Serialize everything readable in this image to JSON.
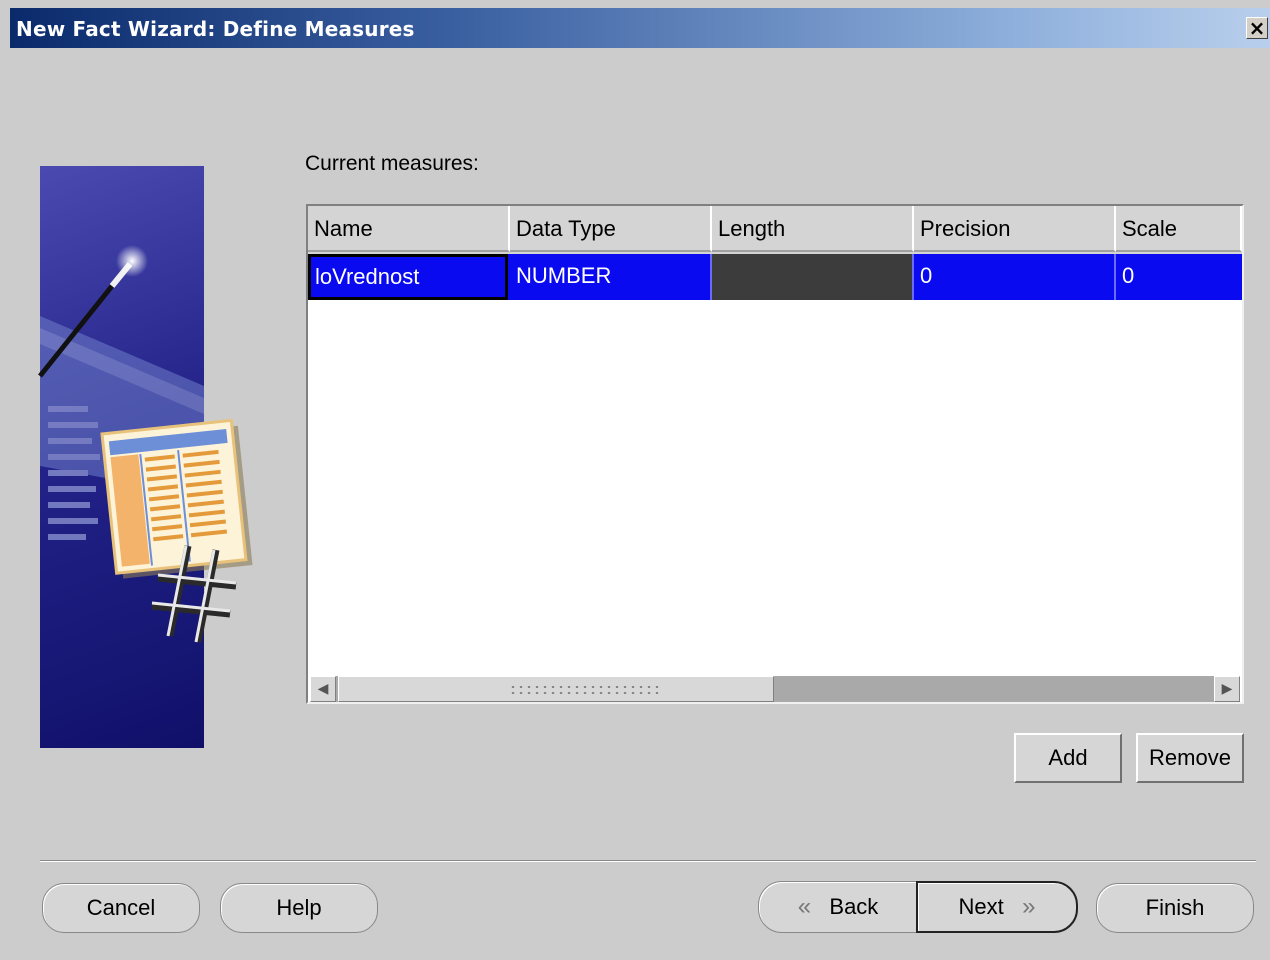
{
  "window": {
    "title": "New Fact Wizard: Define Measures",
    "close_label": "×"
  },
  "main": {
    "current_measures_label": "Current measures:",
    "columns": [
      "Name",
      "Data Type",
      "Length",
      "Precision",
      "Scale"
    ],
    "rows": [
      {
        "name": "loVrednost",
        "data_type": "NUMBER",
        "length": "",
        "precision": "0",
        "scale": "0"
      }
    ],
    "add_label": "Add",
    "remove_label": "Remove"
  },
  "footer": {
    "cancel_label": "Cancel",
    "help_label": "Help",
    "back_label": "Back",
    "next_label": "Next",
    "finish_label": "Finish"
  },
  "colors": {
    "selection": "#0a0af0",
    "title_gradient_start": "#0a2a6b",
    "background": "#cccccc"
  }
}
